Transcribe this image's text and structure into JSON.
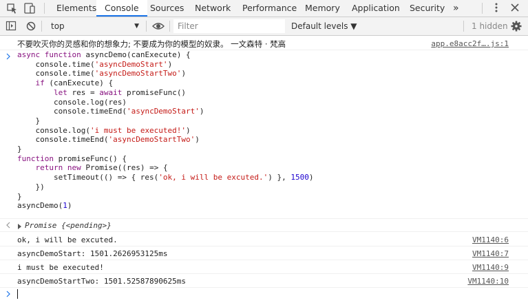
{
  "tabs": [
    "Elements",
    "Console",
    "Sources",
    "Network",
    "Performance",
    "Memory",
    "Application",
    "Security"
  ],
  "more_tabs_glyph": "»",
  "toolbar": {
    "context": "top",
    "filter_placeholder": "Filter",
    "levels": "Default levels ▼",
    "hidden": "1 hidden"
  },
  "console": {
    "top_message": "不要吹灭你的灵感和你的想象力; 不要成为你的模型的奴隶。 一文森特 · 梵高",
    "top_source": "app.e8acc2f….js:1",
    "code_lines": [
      "async function asyncDemo(canExecute) {",
      "    console.time('asyncDemoStart')",
      "    console.time('asyncDemoStartTwo')",
      "    if (canExecute) {",
      "        let res = await promiseFunc()",
      "        console.log(res)",
      "        console.timeEnd('asyncDemoStart')",
      "    }",
      "    console.log('i must be executed!')",
      "    console.timeEnd('asyncDemoStartTwo')",
      "}",
      "function promiseFunc() {",
      "    return new Promise((res) => {",
      "        setTimeout(() => { res('ok, i will be excuted.') }, 1500)",
      "    })",
      "}",
      "asyncDemo(1)"
    ],
    "result": "Promise {<pending>}",
    "logs": [
      {
        "text": "ok, i will be excuted.",
        "source": "VM1140:6"
      },
      {
        "text": "asyncDemoStart: 1501.2626953125ms",
        "source": "VM1140:7"
      },
      {
        "text": "i must be executed!",
        "source": "VM1140:9"
      },
      {
        "text": "asyncDemoStartTwo: 1501.52587890625ms",
        "source": "VM1140:10"
      }
    ]
  }
}
